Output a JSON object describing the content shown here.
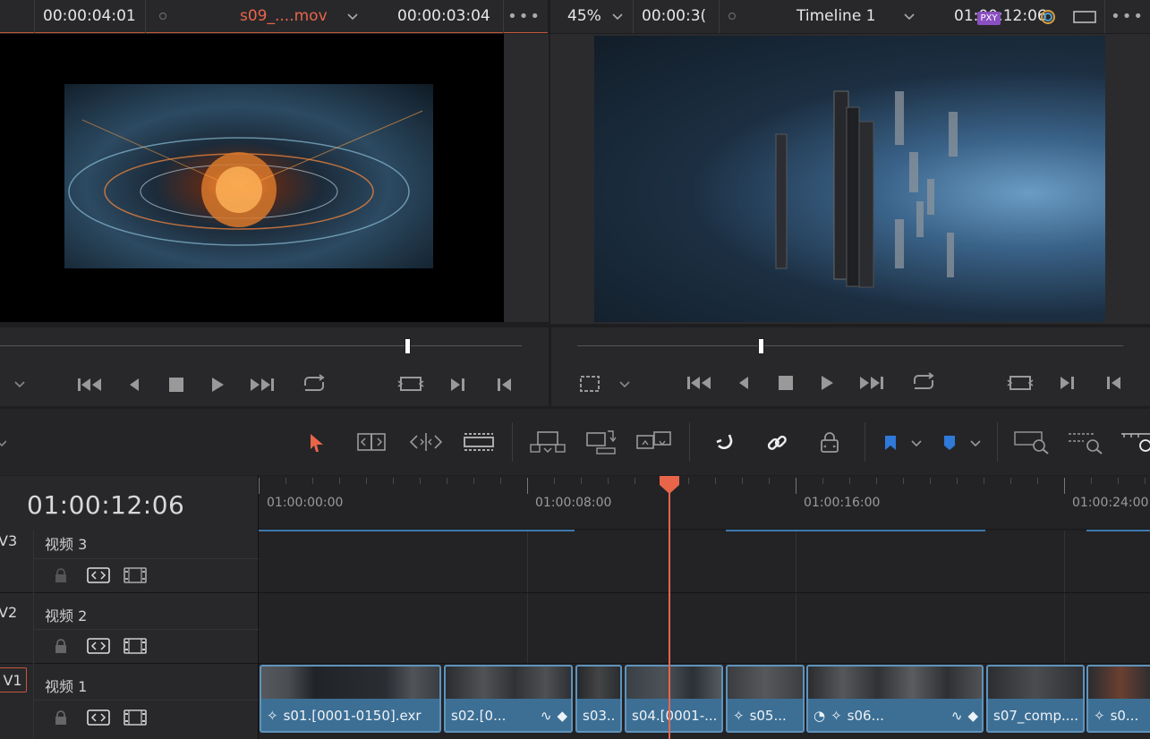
{
  "source_viewer": {
    "timecode_left": "00:00:04:01",
    "clip_name": "s09_....mov",
    "duration": "00:00:03:04"
  },
  "timeline_viewer": {
    "zoom": "45%",
    "timecode_left": "00:00:3(",
    "timeline_name": "Timeline 1",
    "timecode_right": "01:00:12:06",
    "proxy_badge": "PXY"
  },
  "timeline": {
    "current_timecode": "01:00:12:06",
    "ruler_labels": [
      "01:00:00:00",
      "01:00:08:00",
      "01:00:16:00",
      "01:00:24:00"
    ],
    "tracks": [
      {
        "id": "V3",
        "name": "视频 3"
      },
      {
        "id": "V2",
        "name": "视频 2"
      },
      {
        "id": "V1",
        "name": "视频 1"
      }
    ],
    "clips": [
      {
        "label": "s01.[0001-0150].exr"
      },
      {
        "label": "s02.[0..."
      },
      {
        "label": "s03..."
      },
      {
        "label": "s04.[0001-..."
      },
      {
        "label": "s05..."
      },
      {
        "label": "s06..."
      },
      {
        "label": "s07_comp...."
      },
      {
        "label": "s0..."
      }
    ]
  },
  "colors": {
    "accent_orange": "#e8654a",
    "clip_blue": "#3d6f95",
    "flag_blue": "#2f79d8"
  },
  "icons": [
    "skip-to-start-icon",
    "step-back-icon",
    "stop-icon",
    "play-icon",
    "skip-to-end-icon",
    "loop-icon",
    "match-frame-icon",
    "next-edit-icon",
    "prev-edit-icon",
    "selection-tool-icon",
    "trim-tool-icon",
    "dynamic-trim-icon",
    "blade-tool-icon",
    "insert-clip-icon",
    "overwrite-clip-icon",
    "replace-clip-icon",
    "snapping-icon",
    "linked-selection-icon",
    "position-lock-icon",
    "flag-icon",
    "marker-icon",
    "zoom-full-icon",
    "zoom-detail-icon",
    "zoom-custom-icon",
    "lock-icon",
    "auto-select-icon",
    "track-visibility-icon"
  ]
}
